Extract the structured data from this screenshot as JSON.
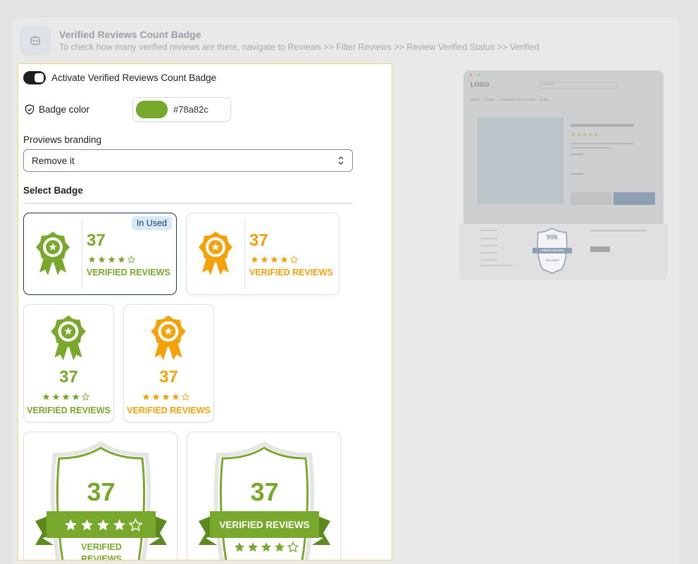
{
  "header": {
    "title": "Verified Reviews Count Badge",
    "subtitle": "To check how many verified reviews are there, navigate to Reviews >> Filter Reviews >> Review Verified Status >> Verified",
    "icon": "robot-icon"
  },
  "settings": {
    "toggle_label": "Activate Verified Reviews Count Badge",
    "toggle_on": true,
    "badge_color_label": "Badge color",
    "badge_color_value": "#78a82c",
    "branding_label": "Proviews branding",
    "branding_value": "Remove it",
    "select_badge_label": "Select Badge"
  },
  "badges": {
    "count": "37",
    "verified_text": "VERIFIED REVIEWS",
    "in_used_label": "In Used",
    "rating": 4,
    "colors": {
      "green": "#78a82c",
      "orange": "#f5a20a",
      "selected_border": "#1f3b57"
    }
  },
  "preview": {
    "logo": "LOGO",
    "search_placeholder": "Search",
    "nav": [
      "SHOP",
      "SALES",
      "SUMMER COLLECTION",
      "BLOG"
    ],
    "badge_count": "99k",
    "badge_text": "VERIFIED REVIEWS",
    "badge_brand": "PROVIEWS"
  }
}
